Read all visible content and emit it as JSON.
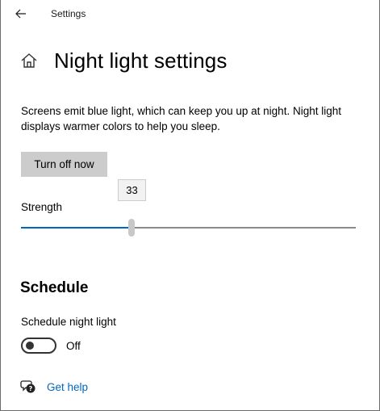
{
  "window": {
    "title": "Settings",
    "back_icon": "back-arrow-icon"
  },
  "header": {
    "home_icon": "home-icon",
    "title": "Night light settings"
  },
  "description": "Screens emit blue light, which can keep you up at night. Night light displays warmer colors to help you sleep.",
  "turn_off_button": "Turn off now",
  "strength": {
    "label": "Strength",
    "value": "33",
    "fraction": 0.33
  },
  "schedule": {
    "title": "Schedule",
    "toggle_label": "Schedule night light",
    "toggle_state": "Off"
  },
  "help": {
    "icon": "help-chat-icon",
    "label": "Get help"
  },
  "colors": {
    "accent": "#0067c0",
    "button_bg": "#cccccc",
    "track": "#8a8a8a"
  }
}
